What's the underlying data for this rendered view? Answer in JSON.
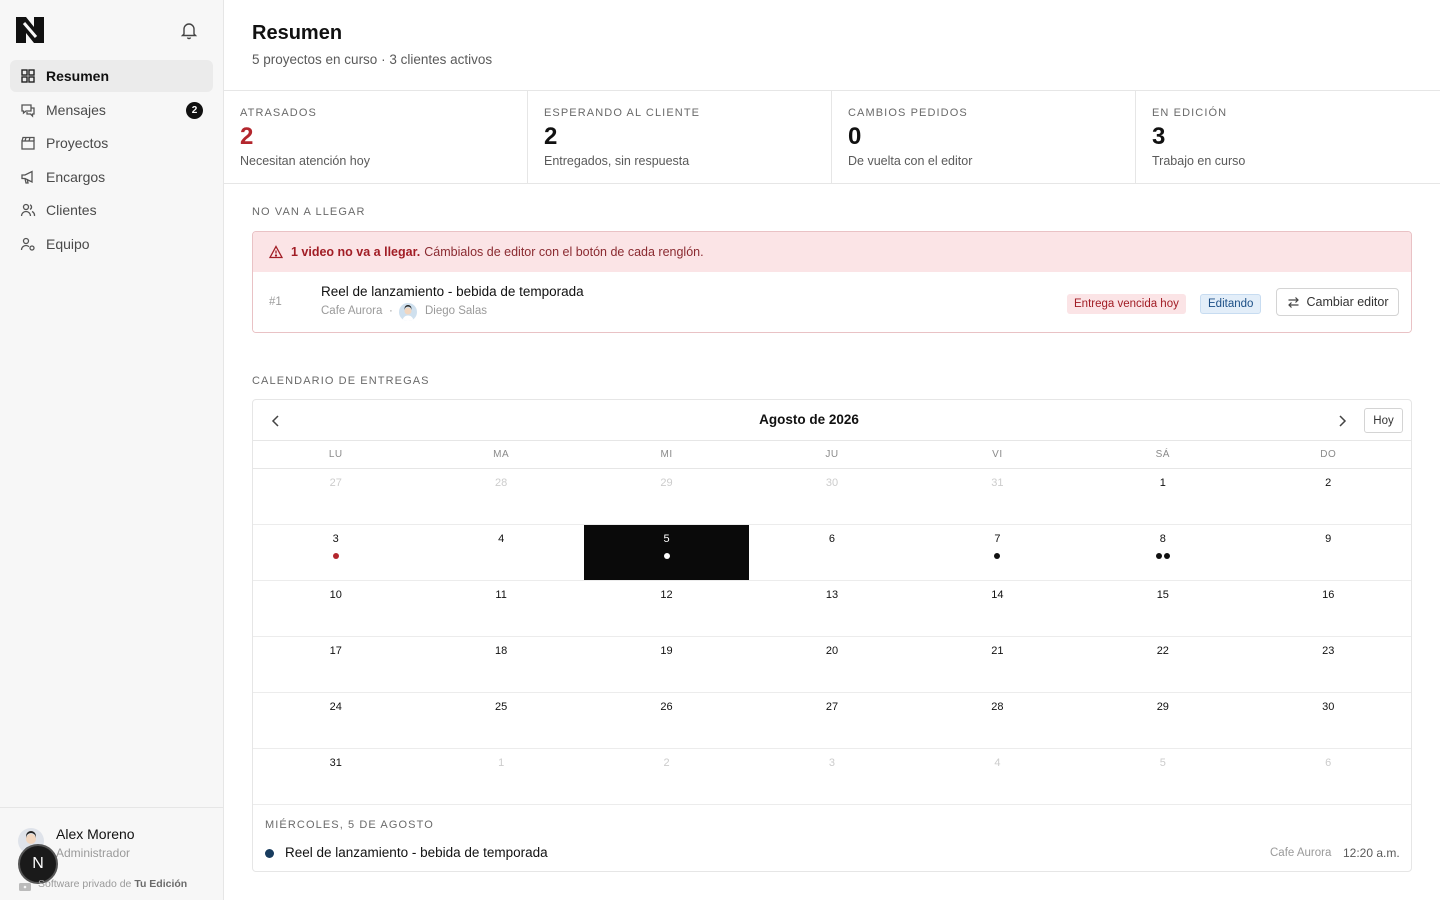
{
  "sidebar": {
    "nav": [
      {
        "label": "Resumen",
        "icon": "grid-icon",
        "active": true
      },
      {
        "label": "Mensajes",
        "icon": "chat-icon",
        "badge": "2"
      },
      {
        "label": "Proyectos",
        "icon": "clapperboard-icon"
      },
      {
        "label": "Encargos",
        "icon": "megaphone-icon"
      },
      {
        "label": "Clientes",
        "icon": "users-icon"
      },
      {
        "label": "Equipo",
        "icon": "user-gear-icon"
      }
    ],
    "user": {
      "name": "Alex Moreno",
      "role": "Administrador"
    },
    "floating_badge": "N",
    "footer": {
      "prefix": "Software privado de",
      "brand": "Tu Edición"
    }
  },
  "header": {
    "title": "Resumen",
    "subtitle": "5 proyectos en curso · 3 clientes activos"
  },
  "stats": [
    {
      "label": "ATRASADOS",
      "value": "2",
      "desc": "Necesitan atención hoy",
      "color": "#b3262d"
    },
    {
      "label": "ESPERANDO AL CLIENTE",
      "value": "2",
      "desc": "Entregados, sin respuesta"
    },
    {
      "label": "CAMBIOS PEDIDOS",
      "value": "0",
      "desc": "De vuelta con el editor"
    },
    {
      "label": "EN EDICIÓN",
      "value": "3",
      "desc": "Trabajo en curso"
    }
  ],
  "late": {
    "section_label": "NO VAN A LLEGAR",
    "alert_bold": "1 video no va a llegar.",
    "alert_text": "Cámbialos de editor con el botón de cada renglón.",
    "rows": [
      {
        "num": "#1",
        "title": "Reel de lanzamiento - bebida de temporada",
        "client": "Cafe Aurora",
        "separator": "·",
        "editor": "Diego Salas",
        "tag_late": "Entrega vencida hoy",
        "tag_status": "Editando",
        "action": "Cambiar editor"
      }
    ]
  },
  "calendar": {
    "section_label": "CALENDARIO DE ENTREGAS",
    "month": "Agosto de 2026",
    "today_label": "Hoy",
    "weekdays": [
      "LU",
      "MA",
      "MI",
      "JU",
      "VI",
      "SÁ",
      "DO"
    ],
    "weeks": [
      [
        {
          "d": "27",
          "m": true
        },
        {
          "d": "28",
          "m": true
        },
        {
          "d": "29",
          "m": true
        },
        {
          "d": "30",
          "m": true
        },
        {
          "d": "31",
          "m": true
        },
        {
          "d": "1"
        },
        {
          "d": "2"
        }
      ],
      [
        {
          "d": "3",
          "dots": [
            "red"
          ]
        },
        {
          "d": "4"
        },
        {
          "d": "5",
          "sel": true,
          "dots": [
            "dark"
          ]
        },
        {
          "d": "6"
        },
        {
          "d": "7",
          "dots": [
            "dark"
          ]
        },
        {
          "d": "8",
          "dots": [
            "dark",
            "dark"
          ]
        },
        {
          "d": "9"
        }
      ],
      [
        {
          "d": "10"
        },
        {
          "d": "11"
        },
        {
          "d": "12"
        },
        {
          "d": "13"
        },
        {
          "d": "14"
        },
        {
          "d": "15"
        },
        {
          "d": "16"
        }
      ],
      [
        {
          "d": "17"
        },
        {
          "d": "18"
        },
        {
          "d": "19"
        },
        {
          "d": "20"
        },
        {
          "d": "21"
        },
        {
          "d": "22"
        },
        {
          "d": "23"
        }
      ],
      [
        {
          "d": "24"
        },
        {
          "d": "25"
        },
        {
          "d": "26"
        },
        {
          "d": "27"
        },
        {
          "d": "28"
        },
        {
          "d": "29"
        },
        {
          "d": "30"
        }
      ],
      [
        {
          "d": "31"
        },
        {
          "d": "1",
          "m": true
        },
        {
          "d": "2",
          "m": true
        },
        {
          "d": "3",
          "m": true
        },
        {
          "d": "4",
          "m": true
        },
        {
          "d": "5",
          "m": true
        },
        {
          "d": "6",
          "m": true
        }
      ]
    ],
    "detail": {
      "label": "MIÉRCOLES, 5 DE AGOSTO",
      "title": "Reel de lanzamiento - bebida de temporada",
      "client": "Cafe Aurora",
      "time": "12:20 a.m."
    }
  },
  "colors": {
    "late_red": "#b3262d",
    "alert_bg": "#fbe4e6",
    "selected_day": "#0a0a0a",
    "event_dot": "#183c5e"
  }
}
